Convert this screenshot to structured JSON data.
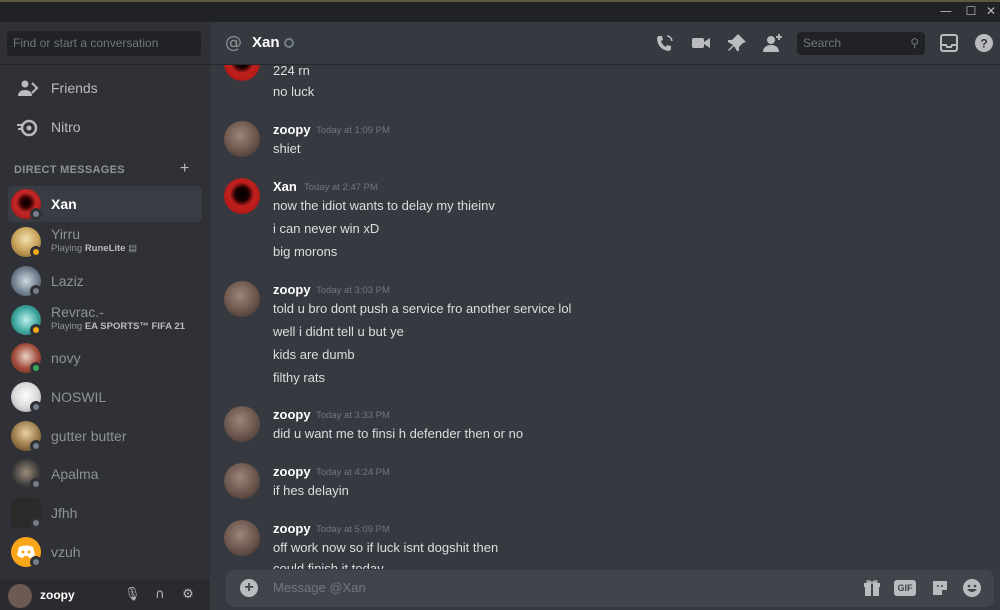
{
  "window": {
    "minimize_glyph": "—",
    "maximize_glyph": "☐",
    "close_glyph": "✕"
  },
  "sidebar": {
    "search_placeholder": "Find or start a conversation",
    "nav": [
      {
        "label": "Friends",
        "icon": "friends-icon"
      },
      {
        "label": "Nitro",
        "icon": "nitro-icon"
      }
    ],
    "dm_header": "DIRECT MESSAGES",
    "dm_add": "+",
    "dms": [
      {
        "name": "Xan",
        "status": "offline",
        "active": true,
        "avatar_color": "#b71c1c"
      },
      {
        "name": "Yirru",
        "activity_prefix": "Playing ",
        "activity": "RuneLite",
        "status": "idle",
        "avatar_color": "#c9a45c"
      },
      {
        "name": "Laziz",
        "status": "offline",
        "avatar_color": "#6c7a8a"
      },
      {
        "name": "Revrac.-",
        "activity_prefix": "Playing ",
        "activity": "EA SPORTS™ FIFA 21",
        "status": "idle",
        "avatar_color": "#3fa8a0"
      },
      {
        "name": "novy",
        "status": "online",
        "avatar_color": "#a04a3a"
      },
      {
        "name": "NOSWIL",
        "status": "offline",
        "avatar_color": "#d8d8d8"
      },
      {
        "name": "gutter butter",
        "status": "offline",
        "avatar_color": "#9a7a4a"
      },
      {
        "name": "Apalma",
        "status": "offline",
        "avatar_color": "#3a3a3a"
      },
      {
        "name": "Jfhh",
        "status": "offline",
        "avatar_color": "#2a2a2a"
      },
      {
        "name": "vzuh",
        "status": "offline",
        "avatar_color": "#faa61a"
      }
    ],
    "user": {
      "name": "zoopy"
    }
  },
  "header": {
    "title": "Xan",
    "search_placeholder": "Search"
  },
  "messages": [
    {
      "lines": [
        "224 rn",
        "no luck"
      ]
    },
    {
      "author": "zoopy",
      "time": "Today at 1:09 PM",
      "avatar": "zoopy",
      "lines": [
        "shiet"
      ]
    },
    {
      "author": "Xan",
      "time": "Today at 2:47 PM",
      "avatar": "xan",
      "lines": [
        "now the idiot wants to delay my thieinv",
        "i can never win xD",
        "big morons"
      ]
    },
    {
      "author": "zoopy",
      "time": "Today at 3:03 PM",
      "avatar": "zoopy",
      "lines": [
        "told u bro dont push a service fro another service lol",
        "well i didnt tell u but ye",
        "kids are dumb",
        "filthy rats"
      ]
    },
    {
      "author": "zoopy",
      "time": "Today at 3:33 PM",
      "avatar": "zoopy",
      "lines": [
        "did u want me to finsi h defender then or no"
      ]
    },
    {
      "author": "zoopy",
      "time": "Today at 4:24 PM",
      "avatar": "zoopy",
      "lines": [
        "if hes delayin"
      ]
    },
    {
      "author": "zoopy",
      "time": "Today at 5:09 PM",
      "avatar": "zoopy",
      "lines": [
        "off work now so if luck isnt dogshit then",
        "could finish it today"
      ]
    }
  ],
  "composer": {
    "placeholder": "Message @Xan",
    "gif_label": "GIF"
  }
}
